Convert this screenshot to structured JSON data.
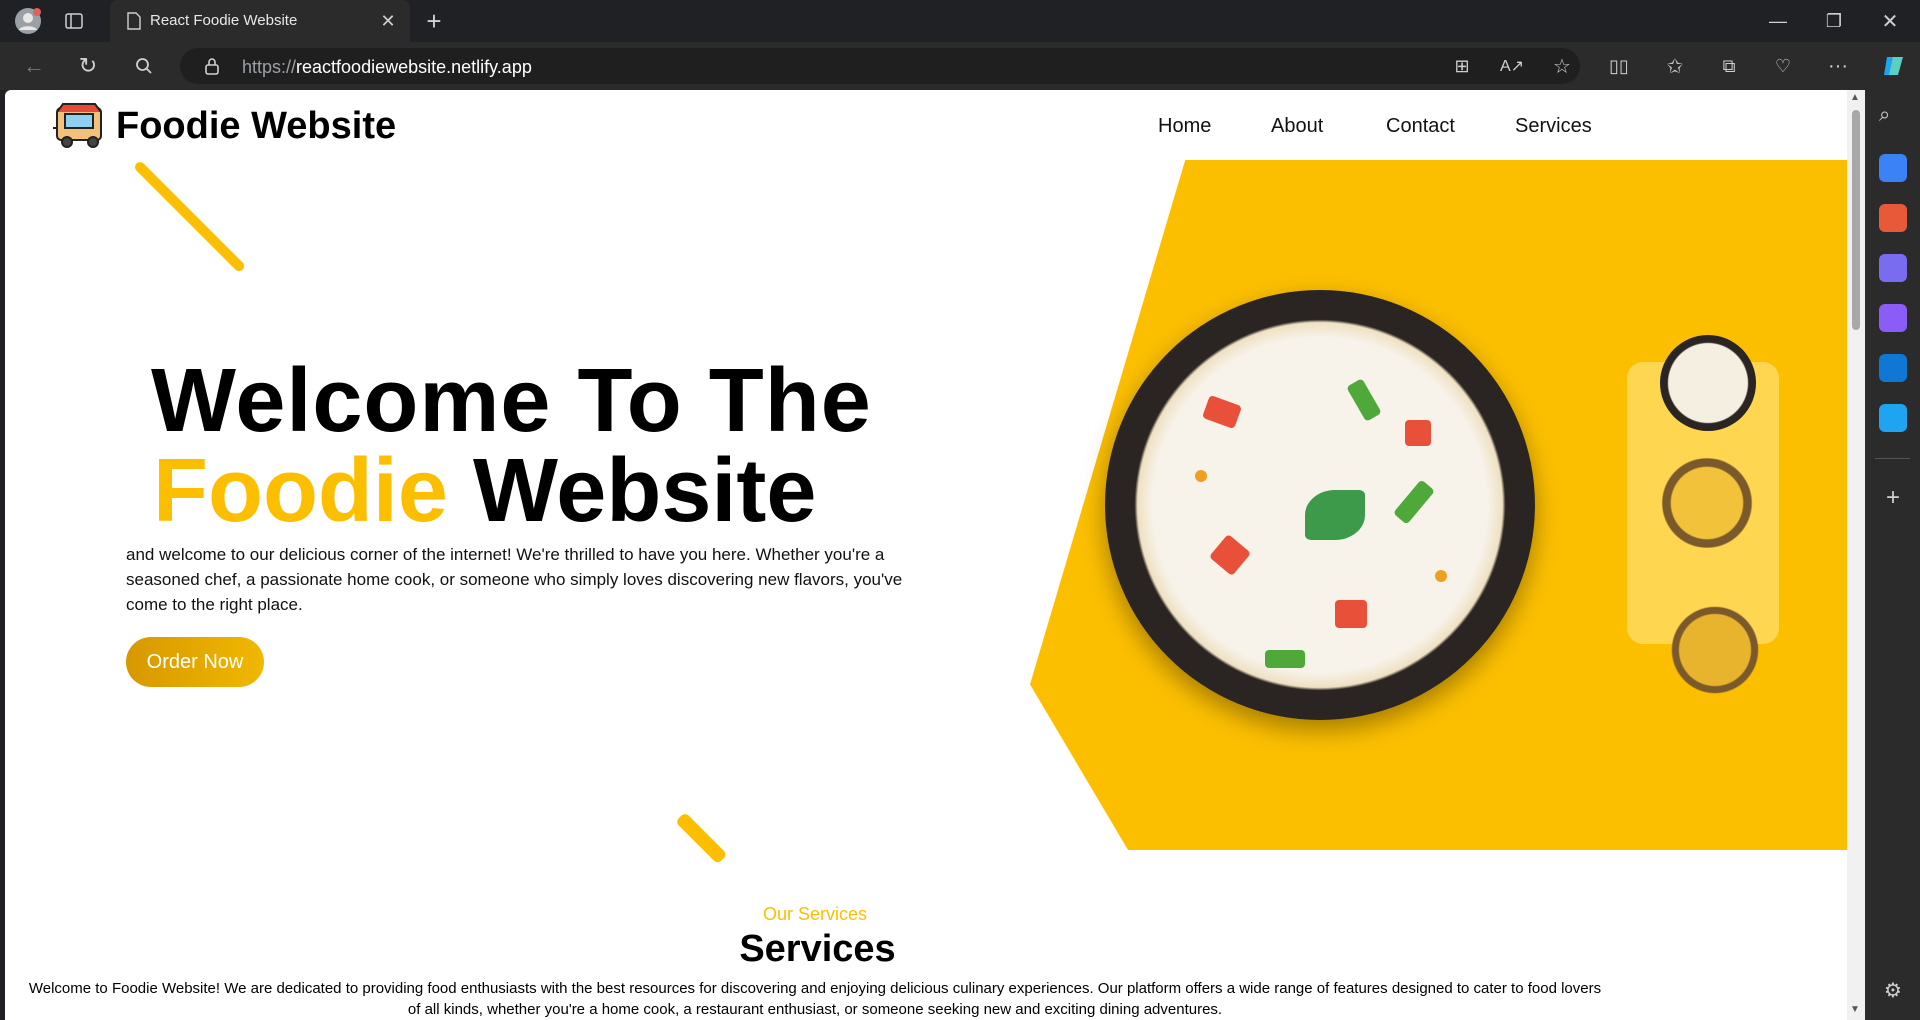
{
  "browser": {
    "tab_title": "React Foodie Website",
    "url_scheme": "https://",
    "url_host": "reactfoodiewebsite.netlify.app"
  },
  "site": {
    "brand": "Foodie Website",
    "nav": [
      "Home",
      "About",
      "Contact",
      "Services"
    ]
  },
  "hero": {
    "title_line1": "Welcome To The",
    "title_highlight": "Foodie",
    "title_line2_rest": " Website",
    "description": "and welcome to our delicious corner of the internet! We're thrilled to have you here. Whether you're a seasoned chef, a passionate home cook, or someone who simply loves discovering new flavors, you've come to the right place.",
    "cta": "Order Now"
  },
  "services": {
    "subtitle": "Our Services",
    "title": "Services",
    "description": "Welcome to Foodie Website! We are dedicated to providing food enthusiasts with the best resources for discovering and enjoying delicious culinary experiences. Our platform offers a wide range of features designed to cater to food lovers of all kinds, whether you're a home cook, a restaurant enthusiast, or someone seeking new and exciting dining adventures."
  },
  "colors": {
    "accent": "#fcbf00",
    "button": "#e0a800"
  }
}
